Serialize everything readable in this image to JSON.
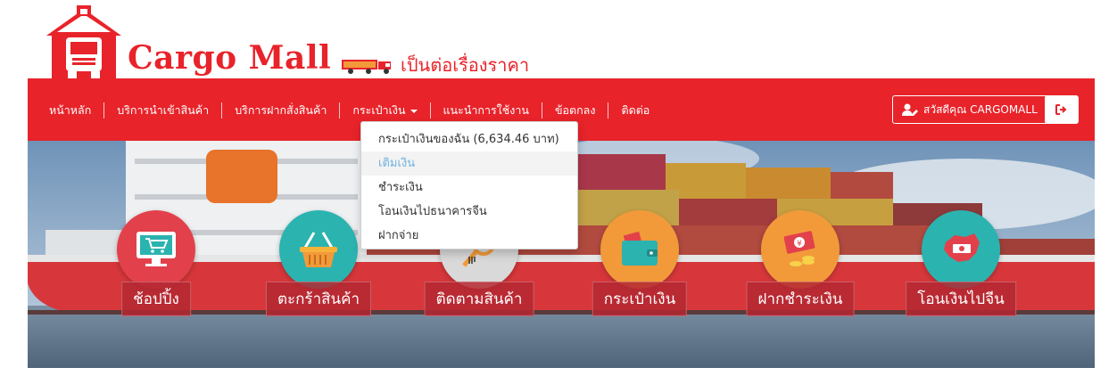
{
  "brand": {
    "name": "Cargo Mall",
    "slogan": "เป็นต่อเรื่องราคา"
  },
  "nav": {
    "items": [
      {
        "label": "หน้าหลัก"
      },
      {
        "label": "บริการนำเข้าสินค้า"
      },
      {
        "label": "บริการฝากสั่งสินค้า"
      },
      {
        "label": "กระเป๋าเงิน",
        "has_dropdown": true
      },
      {
        "label": "แนะนำการใช้งาน"
      },
      {
        "label": "ข้อตกลง"
      },
      {
        "label": "ติดต่อ"
      }
    ],
    "user_greeting": "สวัสดีคุณ CARGOMALL"
  },
  "wallet_menu": {
    "items": [
      {
        "label": "กระเป๋าเงินของฉัน (6,634.46 บาท)"
      },
      {
        "label": "เติมเงิน",
        "active": true
      },
      {
        "label": "ชำระเงิน"
      },
      {
        "label": "โอนเงินไปธนาคารจีน"
      },
      {
        "label": "ฝากจ่าย"
      }
    ]
  },
  "banner": {
    "features": [
      {
        "label": "ช้อปปิ้ง",
        "color": "#e2414b",
        "icon": "shopping-cart-monitor-icon"
      },
      {
        "label": "ตะกร้าสินค้า",
        "color": "#2bb3b0",
        "icon": "basket-icon"
      },
      {
        "label": "ติดตามสินค้า",
        "color": "#d9d9d9",
        "icon": "magnifier-icon"
      },
      {
        "label": "กระเป๋าเงิน",
        "color": "#f29a3a",
        "icon": "wallet-icon"
      },
      {
        "label": "ฝากชำระเงิน",
        "color": "#f29a3a",
        "icon": "yuan-money-icon"
      },
      {
        "label": "โอนเงินไปจีน",
        "color": "#2bb3b0",
        "icon": "china-map-money-icon"
      }
    ]
  },
  "colors": {
    "brand_red": "#e8232a",
    "active_link": "#6fb3e0"
  }
}
